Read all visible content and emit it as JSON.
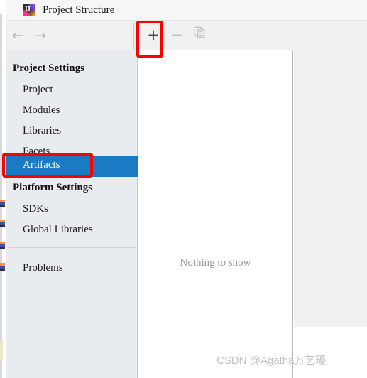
{
  "window": {
    "title": "Project Structure",
    "app_icon": "intellij-idea-icon",
    "icon_mark": "IJ"
  },
  "toolbar": {
    "back_icon": "←",
    "forward_icon": "→",
    "add_label": "+",
    "remove_label": "−",
    "copy_icon": "copy-icon",
    "add_enabled": true,
    "remove_enabled": false,
    "copy_enabled": false
  },
  "sidebar": {
    "groups": [
      {
        "header": "Project Settings",
        "items": [
          {
            "label": "Project",
            "selected": false
          },
          {
            "label": "Modules",
            "selected": false
          },
          {
            "label": "Libraries",
            "selected": false
          },
          {
            "label": "Facets",
            "selected": false
          },
          {
            "label": "Artifacts",
            "selected": true
          }
        ]
      },
      {
        "header": "Platform Settings",
        "items": [
          {
            "label": "SDKs",
            "selected": false
          },
          {
            "label": "Global Libraries",
            "selected": false
          }
        ]
      }
    ],
    "footer_items": [
      {
        "label": "Problems",
        "selected": false
      }
    ]
  },
  "main": {
    "empty_message": "Nothing to show"
  },
  "annotations": {
    "add_button_highlight": "red-rectangle",
    "artifacts_highlight": "red-rectangle",
    "highlight_color": "#fe0000"
  },
  "watermark": {
    "text": "CSDN @Agatha方艺瓇"
  },
  "colors": {
    "selection_blue": "#1a7ac4",
    "sidebar_bg": "#e8ecef",
    "toolbar_bg": "#f1f1f1",
    "content_bg": "#ffffff",
    "muted_text": "#9a9a9a"
  }
}
